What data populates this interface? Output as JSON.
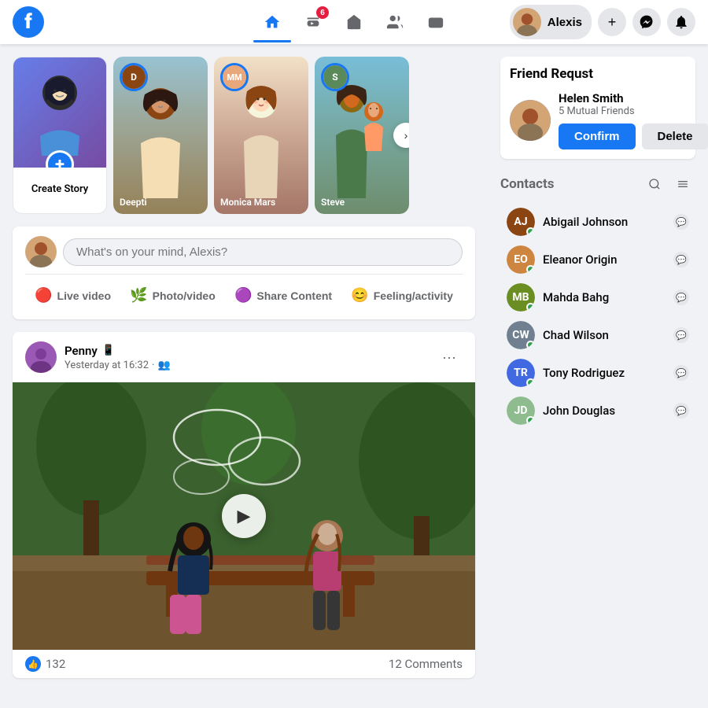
{
  "navbar": {
    "logo": "f",
    "user_name": "Alexis",
    "icons": {
      "home": "🏠",
      "video": "▶",
      "marketplace": "🏪",
      "groups": "👥",
      "gaming": "⊞"
    },
    "badge_count": "6",
    "plus_label": "+",
    "messenger_icon": "💬",
    "notifications_icon": "🔔"
  },
  "stories": {
    "create_label": "Create Story",
    "items": [
      {
        "name": "Deepti",
        "bg": "story-bg-1"
      },
      {
        "name": "Monica Mars",
        "bg": "story-bg-2"
      },
      {
        "name": "Steve",
        "bg": "story-bg-3"
      }
    ]
  },
  "composer": {
    "placeholder": "What's on your mind, Alexis?",
    "actions": [
      {
        "icon": "🔴",
        "label": "Live video"
      },
      {
        "icon": "🟢",
        "label": "Photo/video"
      },
      {
        "icon": "🟣",
        "label": "Share Content"
      },
      {
        "icon": "😊",
        "label": "Feeling/activity"
      }
    ]
  },
  "post": {
    "author": "Penny",
    "timestamp": "Yesterday at 16:32",
    "audience_icon": "👥",
    "likes_count": "132",
    "comments_count": "12 Comments"
  },
  "friend_request": {
    "section_title": "Friend Requst",
    "name": "Helen Smith",
    "mutual": "5 Mutual Friends",
    "confirm_label": "Confirm",
    "delete_label": "Delete"
  },
  "contacts": {
    "title": "Contacts",
    "items": [
      {
        "name": "Abigail Johnson",
        "color": "#8B4513",
        "initials": "AJ"
      },
      {
        "name": "Eleanor Origin",
        "color": "#CD853F",
        "initials": "EO"
      },
      {
        "name": "Mahda Bahg",
        "color": "#6B8E23",
        "initials": "MB"
      },
      {
        "name": "Chad Wilson",
        "color": "#708090",
        "initials": "CW"
      },
      {
        "name": "Tony Rodriguez",
        "color": "#4169E1",
        "initials": "TR"
      },
      {
        "name": "John Douglas",
        "color": "#8FBC8F",
        "initials": "JD"
      }
    ]
  }
}
